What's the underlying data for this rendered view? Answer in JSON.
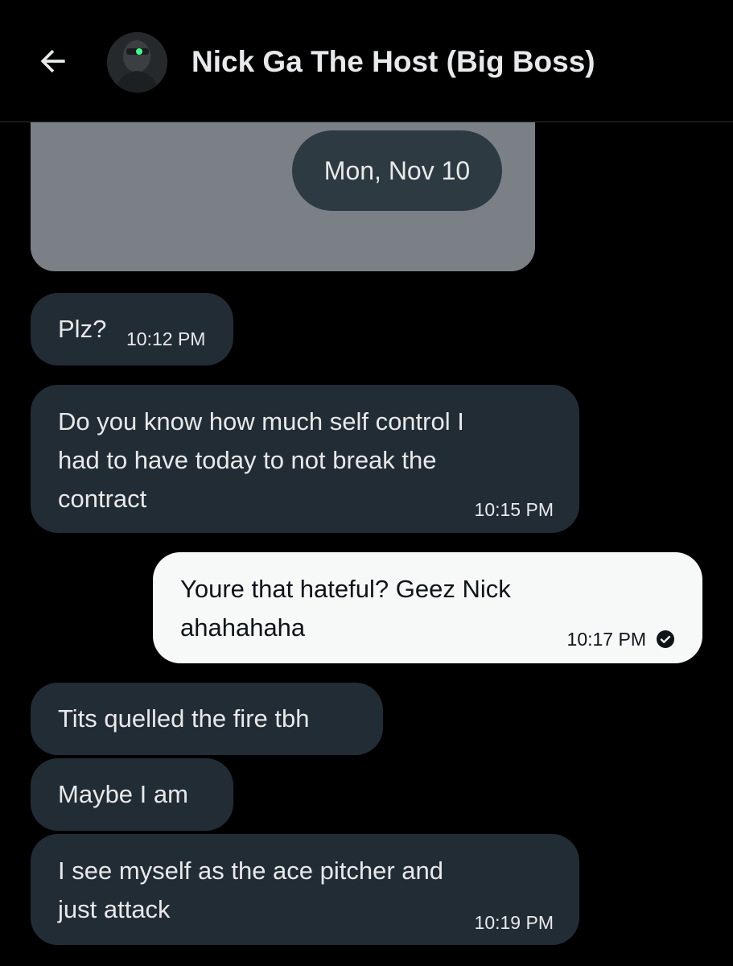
{
  "header": {
    "back_icon": "arrow-left-icon",
    "contact_name": "Nick Ga The Host (Big Boss)",
    "avatar_icon": "avatar-image"
  },
  "media_card": {
    "date_label": "Mon, Nov 10"
  },
  "messages": [
    {
      "direction": "incoming",
      "text": "Plz?",
      "time": "10:12 PM"
    },
    {
      "direction": "incoming",
      "text": "Do you know how much self control I\nhad to have today to not break the\ncontract",
      "time": "10:15 PM"
    },
    {
      "direction": "outgoing",
      "text": "Youre that hateful? Geez Nick\nahahahaha",
      "time": "10:17 PM",
      "status_icon": "read-check-icon"
    },
    {
      "direction": "incoming",
      "text": "Tits quelled the fire tbh"
    },
    {
      "direction": "incoming",
      "text": "Maybe I am"
    },
    {
      "direction": "incoming",
      "text": "I see myself as the ace pitcher and\njust attack",
      "time": "10:19 PM"
    }
  ],
  "colors": {
    "background": "#000000",
    "incoming_bubble": "#222c35",
    "outgoing_bubble": "#f7f9f9",
    "media_card": "#7b8086",
    "date_pill": "#2e3a42",
    "text_light": "#e7e9ea",
    "text_dark": "#0f1419"
  }
}
